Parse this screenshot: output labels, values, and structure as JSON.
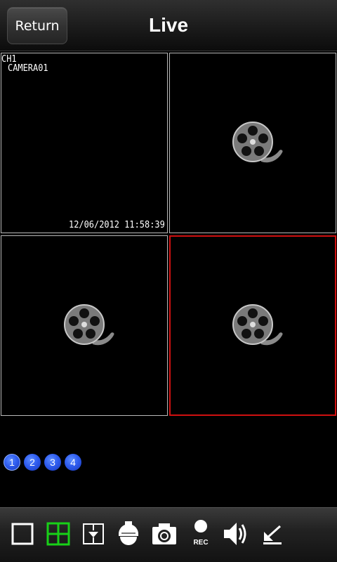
{
  "header": {
    "return_label": "Return",
    "title": "Live"
  },
  "channels": [
    {
      "ch_label": "CH1",
      "camera_name": "CAMERA01",
      "timestamp": "12/06/2012 11:58:39",
      "state": "live"
    },
    {
      "state": "no-video",
      "icon": "film-reel-icon"
    },
    {
      "state": "no-video",
      "icon": "film-reel-icon"
    },
    {
      "state": "no-video",
      "icon": "film-reel-icon",
      "selected": true
    }
  ],
  "pager": {
    "pages": [
      "1",
      "2",
      "3",
      "4"
    ],
    "active": "1"
  },
  "toolbar": {
    "items": [
      {
        "name": "single-view",
        "icon": "single-square-icon"
      },
      {
        "name": "quad-view",
        "icon": "quad-grid-icon",
        "active": true
      },
      {
        "name": "ptz",
        "icon": "ptz-arrow-icon"
      },
      {
        "name": "dome-camera",
        "icon": "dome-camera-icon"
      },
      {
        "name": "snapshot",
        "icon": "camera-icon"
      },
      {
        "name": "record",
        "icon": "record-icon",
        "label": "REC"
      },
      {
        "name": "audio",
        "icon": "speaker-icon"
      },
      {
        "name": "stop-all",
        "icon": "arrow-down-left-icon"
      }
    ]
  },
  "colors": {
    "selected_border": "#d01010",
    "cell_border": "#b8b8b8",
    "quad_active": "#18d018",
    "page_dot": "#2f5df0"
  }
}
